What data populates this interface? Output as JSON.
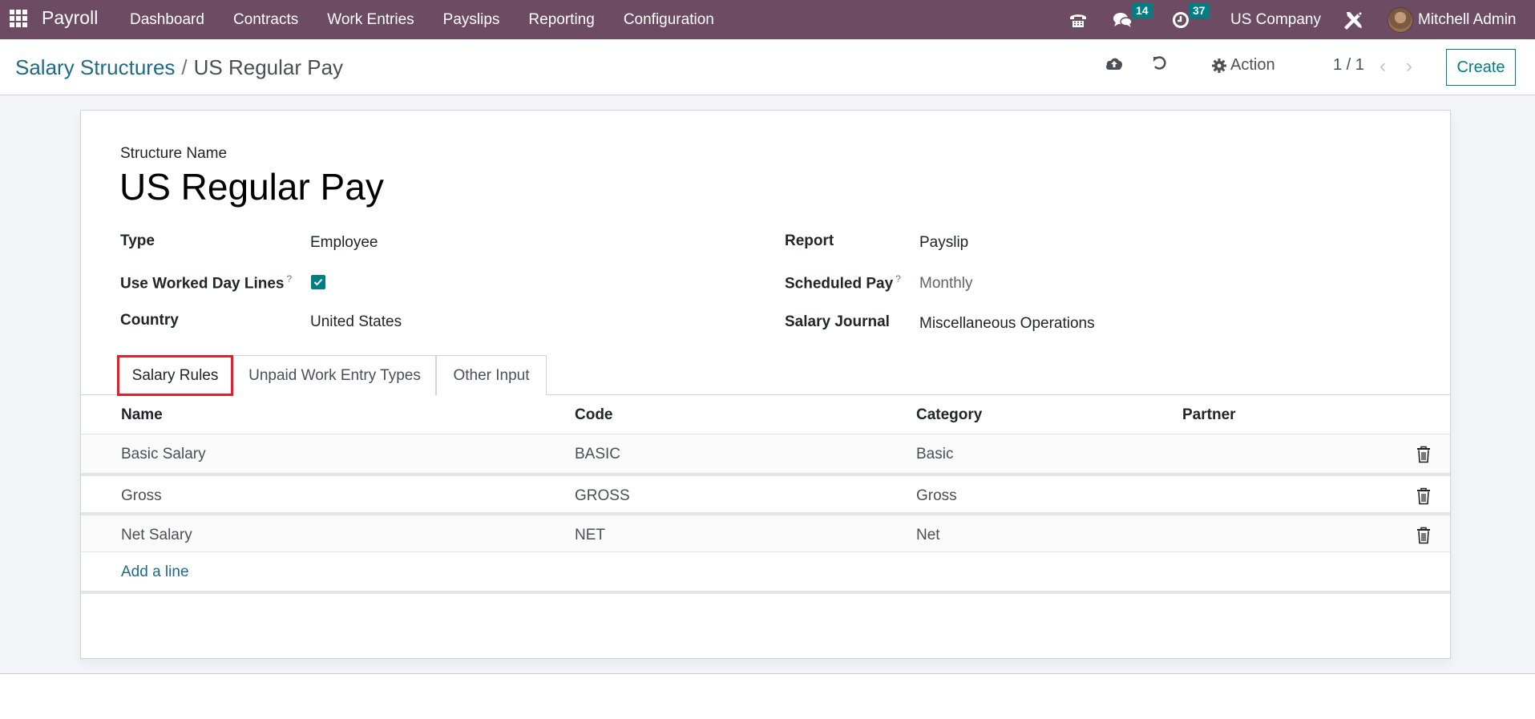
{
  "navbar": {
    "app_name": "Payroll",
    "menu": [
      "Dashboard",
      "Contracts",
      "Work Entries",
      "Payslips",
      "Reporting",
      "Configuration"
    ],
    "messages_count": "14",
    "activities_count": "37",
    "company": "US Company",
    "user": "Mitchell Admin"
  },
  "control_panel": {
    "breadcrumb_parent": "Salary Structures",
    "breadcrumb_separator": "/",
    "breadcrumb_current": "US Regular Pay",
    "action_label": "Action",
    "pager": "1 / 1",
    "create_label": "Create"
  },
  "form": {
    "structure_name_label": "Structure Name",
    "structure_name": "US Regular Pay",
    "left_fields": [
      {
        "label": "Type",
        "value": "Employee"
      },
      {
        "label": "Use Worked Day Lines",
        "help": "?",
        "checked": true
      },
      {
        "label": "Country",
        "value": "United States"
      }
    ],
    "right_fields": [
      {
        "label": "Report",
        "value": "Payslip"
      },
      {
        "label": "Scheduled Pay",
        "help": "?",
        "value": "Monthly"
      },
      {
        "label": "Salary Journal",
        "value": "Miscellaneous Operations"
      }
    ]
  },
  "tabs": [
    {
      "label": "Salary Rules",
      "active": true,
      "highlighted": true
    },
    {
      "label": "Unpaid Work Entry Types",
      "active": false
    },
    {
      "label": "Other Input",
      "active": false
    }
  ],
  "table": {
    "columns": [
      "Name",
      "Code",
      "Category",
      "Partner"
    ],
    "rows": [
      {
        "name": "Basic Salary",
        "code": "BASIC",
        "category": "Basic",
        "partner": ""
      },
      {
        "name": "Gross",
        "code": "GROSS",
        "category": "Gross",
        "partner": ""
      },
      {
        "name": "Net Salary",
        "code": "NET",
        "category": "Net",
        "partner": ""
      }
    ],
    "add_line_label": "Add a line"
  },
  "colors": {
    "navbar": "#6c4b63",
    "accent": "#017e84",
    "link": "#1f6a86",
    "highlight_box": "#e41e2b"
  }
}
